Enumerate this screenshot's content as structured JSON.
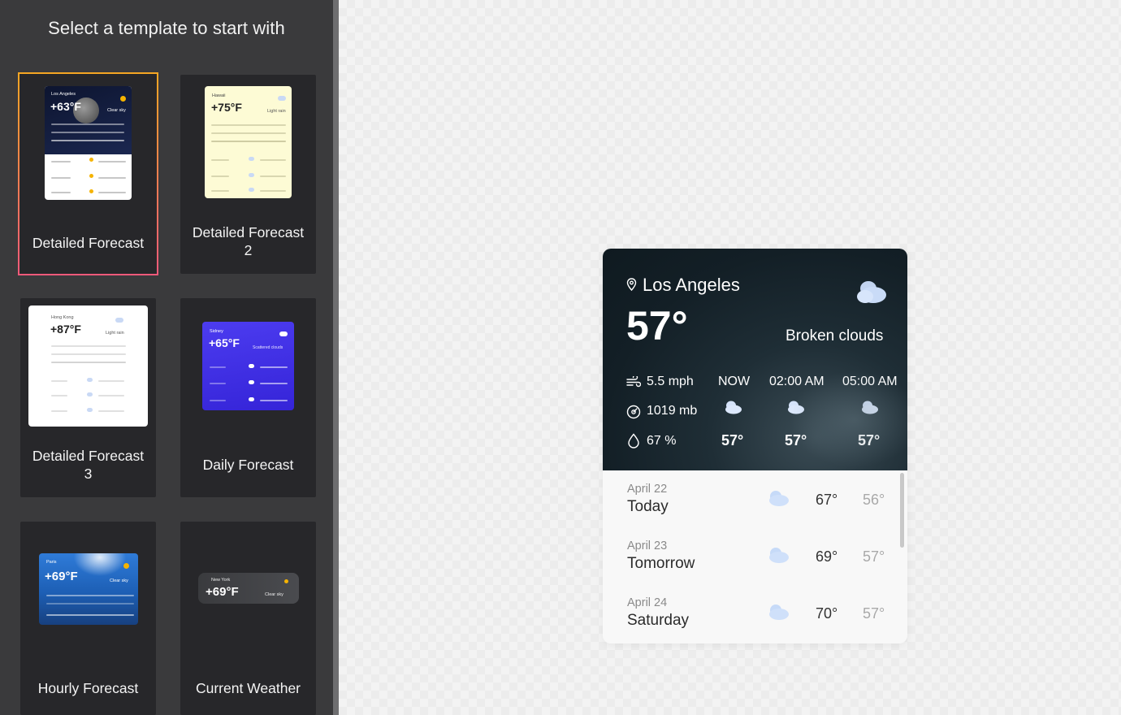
{
  "sidebar": {
    "title": "Select a template to start with",
    "templates": [
      {
        "label": "Detailed Forecast",
        "selected": true
      },
      {
        "label": "Detailed Forecast 2",
        "selected": false
      },
      {
        "label": "Detailed Forecast 3",
        "selected": false
      },
      {
        "label": "Daily Forecast",
        "selected": false
      },
      {
        "label": "Hourly Forecast",
        "selected": false
      },
      {
        "label": "Current Weather",
        "selected": false
      }
    ]
  },
  "thumbs": {
    "t1": {
      "city": "Los Angeles",
      "temp": "+63°F",
      "cond": "Clear sky"
    },
    "t2": {
      "city": "Hawaii",
      "temp": "+75°F",
      "cond": "Light rain"
    },
    "t3": {
      "city": "Hong Kong",
      "temp": "+87°F",
      "cond": "Light rain"
    },
    "t4": {
      "city": "Sidney",
      "temp": "+65°F",
      "cond": "Scattered clouds"
    },
    "t5": {
      "city": "Paris",
      "temp": "+69°F",
      "cond": "Clear sky"
    },
    "t6": {
      "city": "New York",
      "temp": "+69°F",
      "cond": "Clear sky"
    }
  },
  "widget": {
    "city": "Los Angeles",
    "temperature": "57°",
    "condition": "Broken clouds",
    "wind": "5.5 mph",
    "pressure": "1019 mb",
    "humidity": "67 %",
    "hourly": [
      {
        "time": "NOW",
        "temp": "57°"
      },
      {
        "time": "02:00 AM",
        "temp": "57°"
      },
      {
        "time": "05:00 AM",
        "temp": "57°"
      }
    ],
    "daily": [
      {
        "date": "April 22",
        "day": "Today",
        "high": "67°",
        "low": "56°"
      },
      {
        "date": "April 23",
        "day": "Tomorrow",
        "high": "69°",
        "low": "57°"
      },
      {
        "date": "April 24",
        "day": "Saturday",
        "high": "70°",
        "low": "57°"
      }
    ]
  },
  "colors": {
    "sidebar_bg": "#3a3a3c",
    "card_bg": "#27272a",
    "selected_border_top": "#f5a623",
    "selected_border_bottom": "#f0597a",
    "widget_dark": "#131f26",
    "cloud": "#c9d9f5"
  },
  "icons": {
    "location": "location-pin-icon",
    "weather_main": "broken-clouds-icon",
    "wind": "wind-icon",
    "pressure": "pressure-gauge-icon",
    "humidity": "water-drop-icon",
    "hourly": "cloud-icon",
    "daily": "cloud-icon"
  }
}
